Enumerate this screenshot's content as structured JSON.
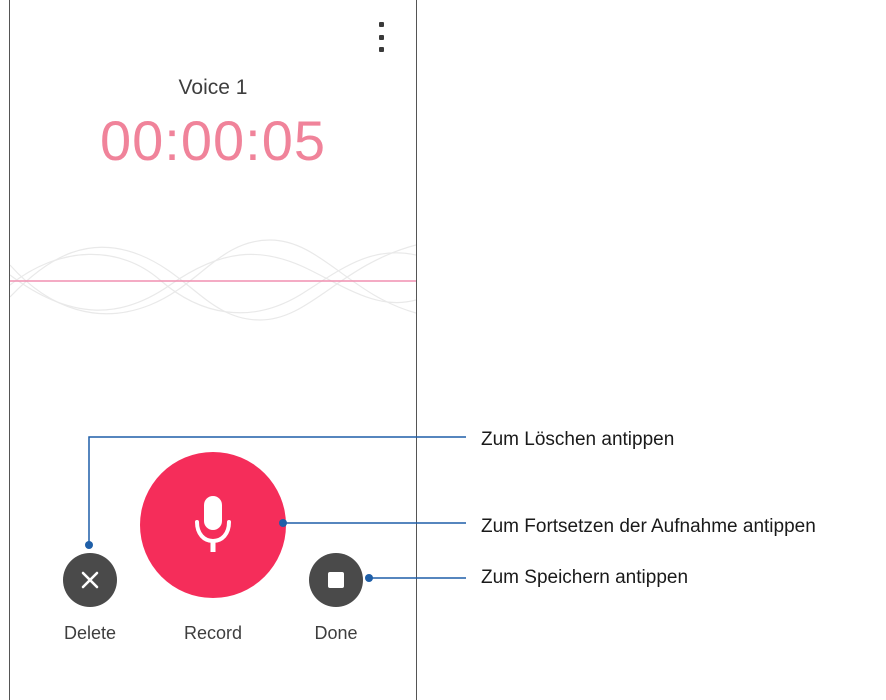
{
  "recording": {
    "title": "Voice 1",
    "elapsed": "00:00:05"
  },
  "menu": {
    "icon": "more-vert-icon"
  },
  "controls": {
    "delete": {
      "label": "Delete",
      "icon": "close-icon"
    },
    "record": {
      "label": "Record",
      "icon": "microphone-icon"
    },
    "done": {
      "label": "Done",
      "icon": "stop-icon"
    }
  },
  "callouts": {
    "delete": "Zum Löschen antippen",
    "record": "Zum Fortsetzen der Aufnahme antippen",
    "done": "Zum Speichern antippen"
  },
  "colors": {
    "accent": "#f52d5a",
    "timer": "#f0839a",
    "waveform_line": "#f08fb0",
    "button_dark": "#4a4a4a",
    "callout_line": "#1f5fa8"
  }
}
